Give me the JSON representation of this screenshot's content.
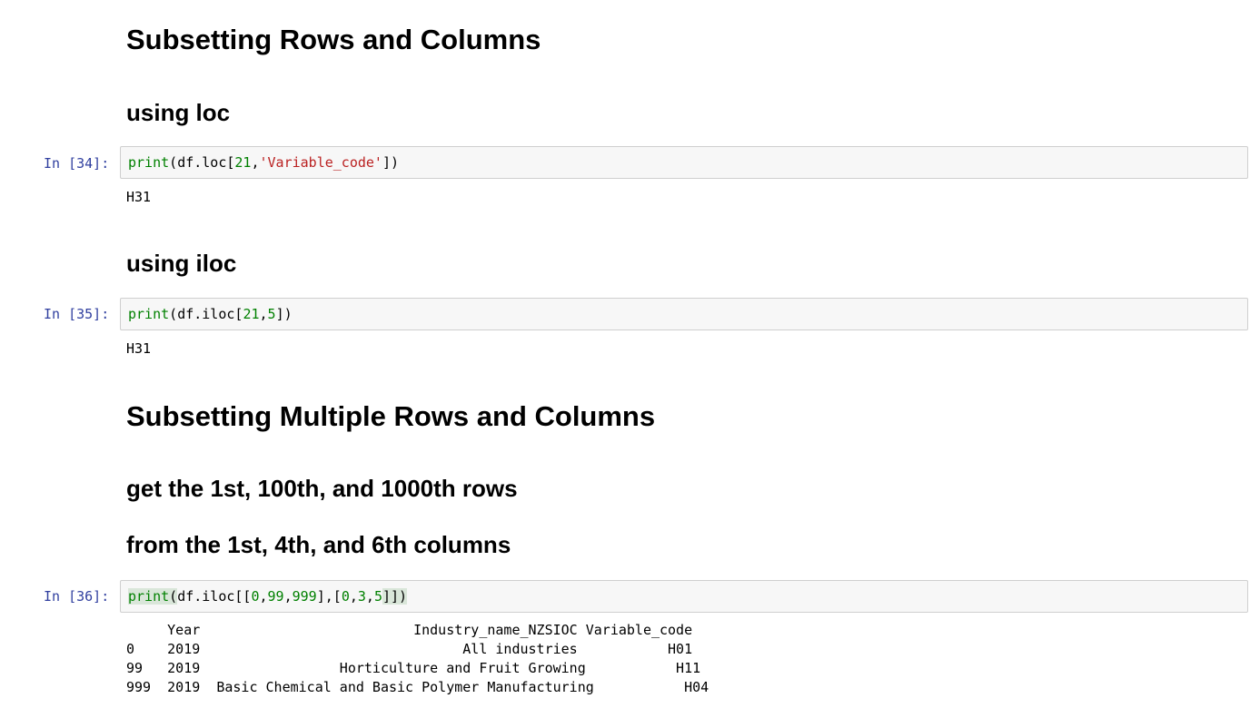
{
  "cells": [
    {
      "type": "heading",
      "level": 1,
      "text": "Subsetting Rows and Columns"
    },
    {
      "type": "heading",
      "level": 2,
      "text": "using loc"
    },
    {
      "type": "code",
      "prompt": "In [34]:",
      "code": {
        "fn": "print",
        "open": "(",
        "obj": "df.loc[",
        "arg1": "21",
        "sep": ",",
        "arg2": "'Variable_code'",
        "close": "])"
      },
      "output": "H31"
    },
    {
      "type": "heading",
      "level": 2,
      "text": "using iloc"
    },
    {
      "type": "code",
      "prompt": "In [35]:",
      "code": {
        "fn": "print",
        "open": "(",
        "obj": "df.iloc[",
        "arg1": "21",
        "sep": ",",
        "arg2": "5",
        "close": "])"
      },
      "output": "H31"
    },
    {
      "type": "heading",
      "level": 1,
      "text": "Subsetting Multiple Rows and Columns"
    },
    {
      "type": "heading",
      "level": 2,
      "text": "get the 1st, 100th, and 1000th rows"
    },
    {
      "type": "heading",
      "level": 2,
      "text": "from the 1st, 4th, and 6th columns"
    },
    {
      "type": "code",
      "prompt": "In [36]:",
      "code": {
        "fn": "print",
        "open": "(",
        "obj": "df.iloc[[",
        "rows": [
          "0",
          "99",
          "999"
        ],
        "mid": "],[",
        "cols": [
          "0",
          "3",
          "5"
        ],
        "close": "]])"
      },
      "output": {
        "header": "     Year                          Industry_name_NZSIOC Variable_code",
        "rows": [
          "0    2019                                All industries           H01",
          "99   2019                 Horticulture and Fruit Growing           H11",
          "999  2019  Basic Chemical and Basic Polymer Manufacturing           H04"
        ]
      }
    }
  ]
}
